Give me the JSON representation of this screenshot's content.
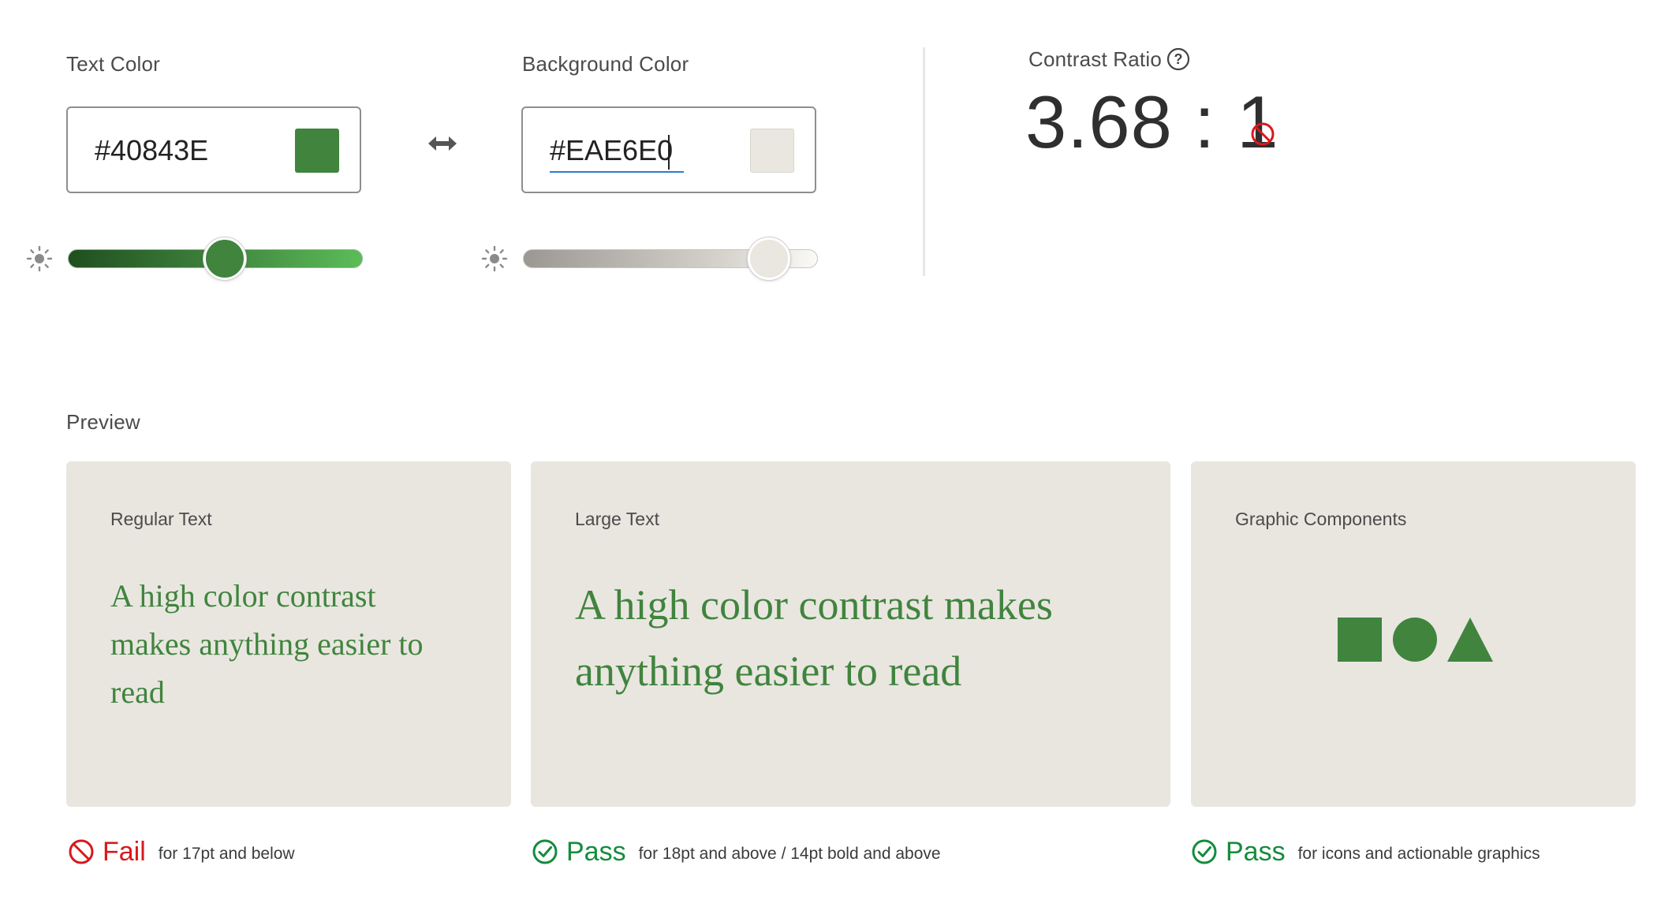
{
  "text_color": {
    "label": "Text Color",
    "hex": "#40843E",
    "swatch": "#40843e",
    "slider_value": 0.53
  },
  "background_color": {
    "label": "Background Color",
    "hex": "#EAE6E0",
    "swatch": "#eae6e0",
    "slider_value": 0.85
  },
  "contrast": {
    "label": "Contrast Ratio",
    "value": "3.68 : 1",
    "help_icon": "question-circle-icon",
    "status_icon": "fail-circle-slash-icon"
  },
  "preview": {
    "label": "Preview",
    "cards": {
      "regular": {
        "title": "Regular Text",
        "sample": "A high color contrast makes anything easier to read"
      },
      "large": {
        "title": "Large Text",
        "sample": "A high color contrast makes anything easier to read"
      },
      "graphic": {
        "title": "Graphic Components",
        "shapes": [
          "square",
          "circle",
          "triangle"
        ]
      }
    },
    "results": {
      "regular": {
        "status": "Fail",
        "description": "for 17pt and below",
        "icon": "fail-circle-slash-icon",
        "color": "#d7191c"
      },
      "large": {
        "status": "Pass",
        "description": "for 18pt and above / 14pt bold and above",
        "icon": "checkmark-circle-icon",
        "color": "#148c3c"
      },
      "graphic": {
        "status": "Pass",
        "description": "for icons and actionable graphics",
        "icon": "checkmark-circle-icon",
        "color": "#148c3c"
      }
    }
  }
}
